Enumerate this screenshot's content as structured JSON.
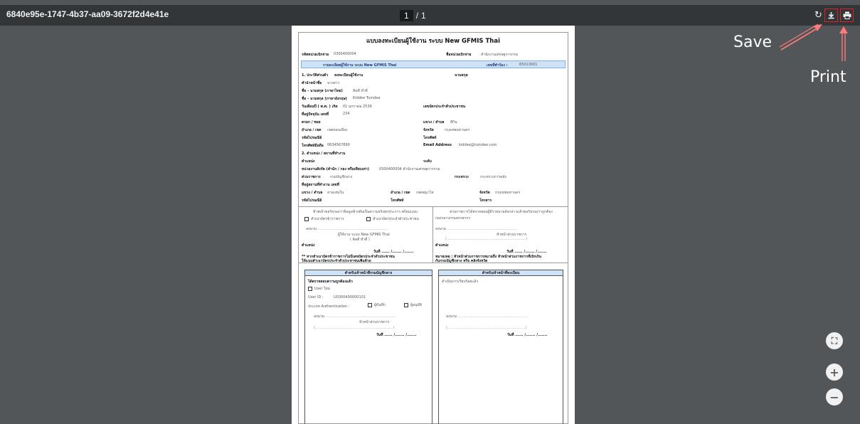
{
  "viewer": {
    "document_title": "6840e95e-1747-4b37-aa09-3672f2d4e41e",
    "page_current": "1",
    "page_separator": "/",
    "page_total": "1",
    "rotate_glyph": "↻",
    "download_glyph": "⤓",
    "print_glyph": "⎙",
    "fit_glyph": "⛶",
    "zoom_in_glyph": "+",
    "zoom_out_glyph": "−"
  },
  "annotations": {
    "save_label": "Save",
    "print_label": "Print",
    "highlight_color": "#e02020"
  },
  "form": {
    "title": "แบบลงทะเบียนผู้ใช้งาน ระบบ New GFMIS Thai",
    "agency_code_label": "รหัสหน่วยเบิกจ่าย",
    "agency_code_value": "0300400004",
    "agency_name_label": "ชื่อหน่วยเบิกจ่าย",
    "agency_name_value": "สำนักงานเศรษฐการกรม",
    "band_title": "รายละเอียดผู้ใช้งาน ระบบ New GFMIS Thai",
    "request_no_label": "เลขที่คำร้อง :",
    "request_no_value": "65013001",
    "section1": "1. ประวัติส่วนตัว",
    "register_user": "ลงทะเบียนผู้ใช้งาน",
    "surname_label": "นามสกุล",
    "prefix_label": "คำนำหน้าชื่อ",
    "prefix_value": "นางสาว",
    "name_th_label": "ชื่อ - นามสกุล (ภาษาไทย)",
    "name_th_value": "คิดดี ทำดี",
    "name_en_label": "ชื่อ - นามสกุล (ภาษาอังกฤษ)",
    "name_en_value": "Kiddee Tumdee",
    "dob_label": "วันเดือนปี ( พ.ศ. ) เกิด",
    "dob_value": "01 มกราคม 2539",
    "id_card_label": "เลขบัตรประจำตัวประชาชน",
    "addr_no_label": "ที่อยู่ปัจจุบัน เลขที่",
    "addr_no_value": "234",
    "alley_label": "ตรอก / ซอย",
    "subdistrict_label": "แขวง / ตำบล",
    "subdistrict_value": "สีกัน",
    "district_label": "อำเภอ / เขต",
    "district_value": "เขตดอนเมือง",
    "province_label": "จังหวัด",
    "province_value": "กรุงเทพมหานคร",
    "postcode_label": "รหัสไปรษณีย์",
    "phone_label": "โทรศัพท์",
    "mobile_label": "โทรศัพท์มือถือ",
    "mobile_value": "0634567890",
    "email_label": "Email Address",
    "email_value": "kiddee@tumdee.com",
    "section2": "2. ตำแหน่ง / สถานที่ทำงาน",
    "position_label": "ตำแหน่ง",
    "level_label": "ระดับ",
    "unit_label": "หน่วยงานสังกัด (สำนัก / กอง หรือเทียบเท่า)",
    "unit_value": "0300400004 สำนักงานเศรษฐการกรม",
    "department_label": "ส่วนราชการ",
    "department_value": "กรมบัญชีกลาง",
    "ministry_label": "กระทรวง",
    "ministry_value": "กระทรวงการคลัง",
    "work_addr_label": "ที่อยู่สถานที่ทำงาน เลขที่",
    "work_subdistrict_label": "แขวง / ตำบล",
    "work_subdistrict_value": "สามเสนใน",
    "work_district_label": "อำเภอ / เขต",
    "work_district_value": "เขตพญาไท",
    "work_province_label": "จังหวัด",
    "work_province_value": "กรุงเทพมหานคร",
    "work_postcode_label": "รหัสไปรษณีย์",
    "work_phone_label": "โทรศัพท์",
    "fax_label": "โทรสาร",
    "left_cert_text": "ข้าพเจ้าขอรับรองว่าข้อมูลข้างต้นเป็นความจริงทุกประการ พร้อมแนบ",
    "attach_gov_card": "สำเนาบัตรข้าราชการ",
    "attach_id_card": "สำเนาบัตรประจำตัวประชาชน",
    "sign_line": "ลงนาม",
    "user_caption": "ผู้ใช้งาน ระบบ New GFMIS Thai",
    "user_name_paren": "( คิดดี ทำดี )",
    "position_short": "ตำแหน่ง",
    "date_line": "วันที่ ...... /....... /.......",
    "left_note_1": "** หากสำเนาบัตรข้าราชการไม่มีเลขบัตรประจำตัวประชาชน",
    "left_note_2": "ให้แนบสำเนาบัตรประจำตัวประชาชนเพิ่มด้วย",
    "right_cert_text": "ส่วนราชการได้ตรวจสอบผู้มีรายนามดังกล่าวแล้วขอรับรองว่าถูกต้อง",
    "right_dept": "กองกลางกรมสรรพากร",
    "head_caption": "หัวหน้าส่วนราชการ",
    "right_note_1": "หมายเหตุ : หัวหน้าส่วนราชการหมายถึง หัวหน้าส่วนราชการที่เบิกเงิน",
    "right_note_2": "กับกรมบัญชีกลาง หรือ คลังจังหวัด",
    "cgd_box_title": "สำหรับเจ้าหน้าที่กรมบัญชีกลาง",
    "cgd_check_label": "ได้ตรวจสอบความถูกต้องแล้ว",
    "new_user": "User ใหม่",
    "user_id_label": "User ID :",
    "user_id_value": "U0300400000101",
    "auth_label": "ประเภท Authentication :",
    "auth_option1": "ผู้บันทึก",
    "auth_option2": "ผู้อนุมัติ",
    "registrar_box_title": "สำหรับเจ้าหน้าที่ทะเบียน",
    "registrar_done": "ดำเนินการเรียบร้อยแล้ว"
  }
}
